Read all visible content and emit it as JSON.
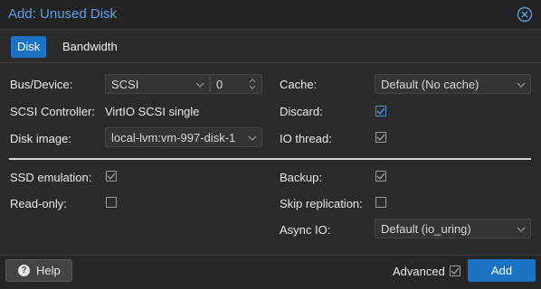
{
  "dialog": {
    "title": "Add: Unused Disk",
    "close_icon": "close-circle-icon"
  },
  "tabs": [
    {
      "label": "Disk",
      "active": true
    },
    {
      "label": "Bandwidth",
      "active": false
    }
  ],
  "form": {
    "bus_device": {
      "label": "Bus/Device:",
      "bus": "SCSI",
      "device": "0"
    },
    "scsi_controller": {
      "label": "SCSI Controller:",
      "value": "VirtIO SCSI single"
    },
    "disk_image": {
      "label": "Disk image:",
      "value": "local-lvm:vm-997-disk-1"
    },
    "cache": {
      "label": "Cache:",
      "value": "Default (No cache)"
    },
    "discard": {
      "label": "Discard:",
      "checked": true
    },
    "io_thread": {
      "label": "IO thread:",
      "checked": true
    },
    "ssd_emulation": {
      "label": "SSD emulation:",
      "checked": true
    },
    "read_only": {
      "label": "Read-only:",
      "checked": false
    },
    "backup": {
      "label": "Backup:",
      "checked": true
    },
    "skip_replication": {
      "label": "Skip replication:",
      "checked": false
    },
    "async_io": {
      "label": "Async IO:",
      "value": "Default (io_uring)"
    }
  },
  "footer": {
    "help_label": "Help",
    "advanced_label": "Advanced",
    "advanced_checked": true,
    "add_label": "Add"
  },
  "colors": {
    "accent": "#1a73c4",
    "title": "#5aa0e6",
    "background": "#2b2b2b"
  }
}
